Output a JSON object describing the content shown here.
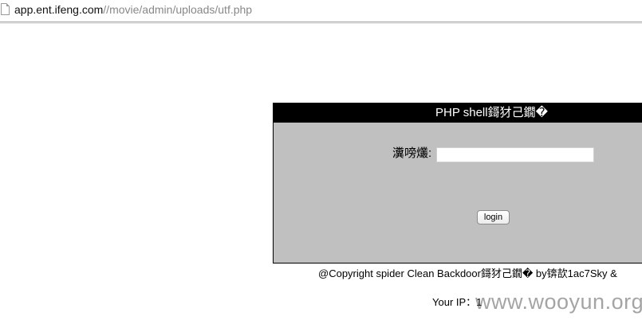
{
  "address_bar": {
    "host": "app.ent.ifeng.com",
    "path": "//movie/admin/uploads/utf.php"
  },
  "panel": {
    "title": "PHP shell鎶犲己鐗�",
    "password_label": "瀵嗙爜:",
    "password_value": "",
    "login_button": "login"
  },
  "footer": {
    "copyright": "@Copyright spider Clean Backdoor鎶犲己鐗� by锛欯1ac7Sky &",
    "your_ip": "Your IP：1"
  },
  "watermark": "www.wooyun.org",
  "colors": {
    "panel_bg": "#c0c0c0",
    "title_bg": "#000000",
    "title_text": "#ffffff"
  }
}
